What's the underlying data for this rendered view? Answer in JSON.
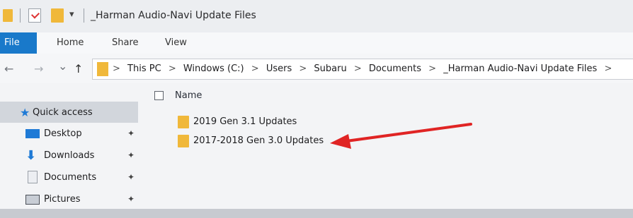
{
  "window": {
    "title": "_Harman Audio-Navi Update Files"
  },
  "quick_access_toolbar": {
    "dropdown": "▾"
  },
  "ribbon": {
    "tabs": [
      "File",
      "Home",
      "Share",
      "View"
    ]
  },
  "navigation": {
    "back": "←",
    "forward": "→",
    "recent": "⌄",
    "up": "↑"
  },
  "address_bar": {
    "crumbs": [
      "This PC",
      "Windows (C:)",
      "Users",
      "Subaru",
      "Documents",
      "_Harman Audio-Navi Update Files"
    ],
    "separator": ">"
  },
  "nav_pane": {
    "items": [
      {
        "label": "Quick access",
        "icon": "star-icon"
      },
      {
        "label": "Desktop",
        "icon": "desktop-icon",
        "pin": "📌"
      },
      {
        "label": "Downloads",
        "icon": "download-icon",
        "pin": "📌"
      },
      {
        "label": "Documents",
        "icon": "document-icon",
        "pin": "📌"
      },
      {
        "label": "Pictures",
        "icon": "pictures-icon",
        "pin": "📌"
      }
    ]
  },
  "file_list": {
    "column_header": "Name",
    "items": [
      {
        "name": "2019 Gen 3.1 Updates",
        "type": "folder"
      },
      {
        "name": "2017-2018 Gen 3.0 Updates",
        "type": "folder"
      }
    ]
  },
  "colors": {
    "file_tab": "#1979ca",
    "folder": "#f0b83a",
    "annotation_arrow": "#e02424"
  }
}
